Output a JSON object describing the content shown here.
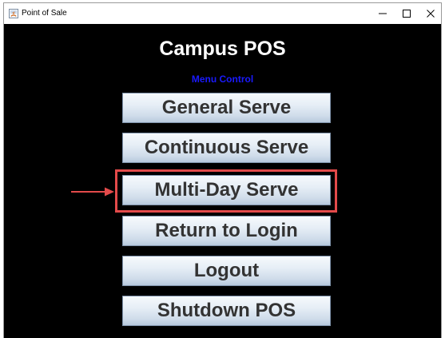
{
  "window": {
    "title": "Point of Sale",
    "icon": "java-app-icon",
    "controls": {
      "minimize_icon": "minimize-icon",
      "maximize_icon": "maximize-icon",
      "close_icon": "close-icon"
    }
  },
  "main": {
    "title": "Campus POS",
    "subtitle": "Menu Control",
    "subtitle_color": "#1a1aff",
    "buttons": [
      {
        "label": "General Serve"
      },
      {
        "label": "Continuous Serve"
      },
      {
        "label": "Multi-Day Serve"
      },
      {
        "label": "Return to Login"
      },
      {
        "label": "Logout"
      },
      {
        "label": "Shutdown POS"
      }
    ]
  },
  "annotation": {
    "highlighted_button": "Multi-Day Serve",
    "color": "#e34a4a",
    "arrow_icon": "arrow-right-icon"
  },
  "colors": {
    "background": "#000000",
    "title_text": "#ffffff",
    "button_text": "#333333"
  }
}
